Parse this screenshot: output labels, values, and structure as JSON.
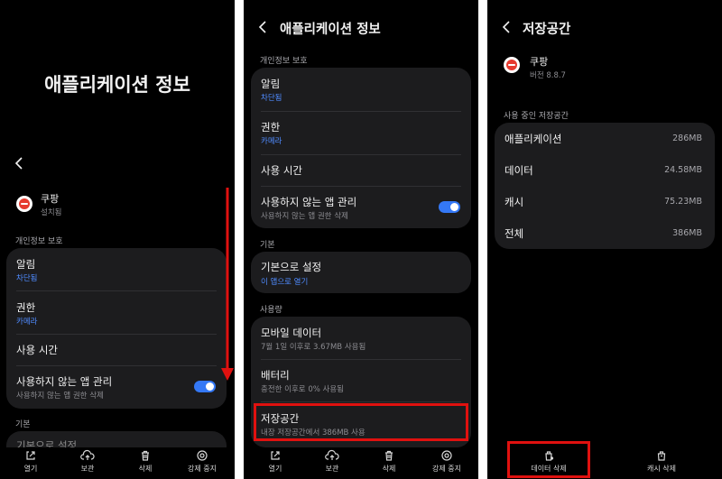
{
  "colors": {
    "accent_blue": "#3478f6",
    "link_blue": "#4f8bff",
    "highlight_red": "#e0110f",
    "card": "#1c1c1e"
  },
  "panel1": {
    "large_title": "애플리케이션 정보",
    "app": {
      "name": "쿠팡",
      "status": "설치됨"
    },
    "privacy_header": "개인정보 보호",
    "notifications": {
      "title": "알림",
      "sub": "차단됨"
    },
    "permissions": {
      "title": "권한",
      "sub": "카메라"
    },
    "usage_time": {
      "title": "사용 시간"
    },
    "unused": {
      "title": "사용하지 않는 앱 관리",
      "sub": "사용하지 않는 앱 권한 삭제"
    },
    "basic_header": "기본",
    "set_default_partial": "기본으로 설정"
  },
  "panel2": {
    "header_title": "애플리케이션 정보",
    "privacy_header": "개인정보 보호",
    "notifications": {
      "title": "알림",
      "sub": "차단됨"
    },
    "permissions": {
      "title": "권한",
      "sub": "카메라"
    },
    "usage_time": {
      "title": "사용 시간"
    },
    "unused": {
      "title": "사용하지 않는 앱 관리",
      "sub": "사용하지 않는 앱 권한 삭제"
    },
    "basic_header": "기본",
    "set_default": {
      "title": "기본으로 설정",
      "sub": "이 앱으로 열기"
    },
    "usage_header": "사용량",
    "mobile_data": {
      "title": "모바일 데이터",
      "sub": "7월 1일 이후로 3.67MB 사용됨"
    },
    "battery": {
      "title": "배터리",
      "sub": "충전한 이후로 0% 사용됨"
    },
    "storage": {
      "title": "저장공간",
      "sub": "내장 저장공간에서 386MB 사용"
    }
  },
  "bottom_bar": {
    "open": "열기",
    "archive": "보관",
    "delete": "삭제",
    "force_stop": "강제 중지"
  },
  "panel3": {
    "header_title": "저장공간",
    "app": {
      "name": "쿠팡",
      "version": "버전 8.8.7"
    },
    "storage_header": "사용 중인 저장공간",
    "rows": [
      {
        "label": "애플리케이션",
        "value": "286MB"
      },
      {
        "label": "데이터",
        "value": "24.58MB"
      },
      {
        "label": "캐시",
        "value": "75.23MB"
      },
      {
        "label": "전체",
        "value": "386MB"
      }
    ],
    "clear_data": "데이터 삭제",
    "clear_cache": "캐시 삭제"
  }
}
